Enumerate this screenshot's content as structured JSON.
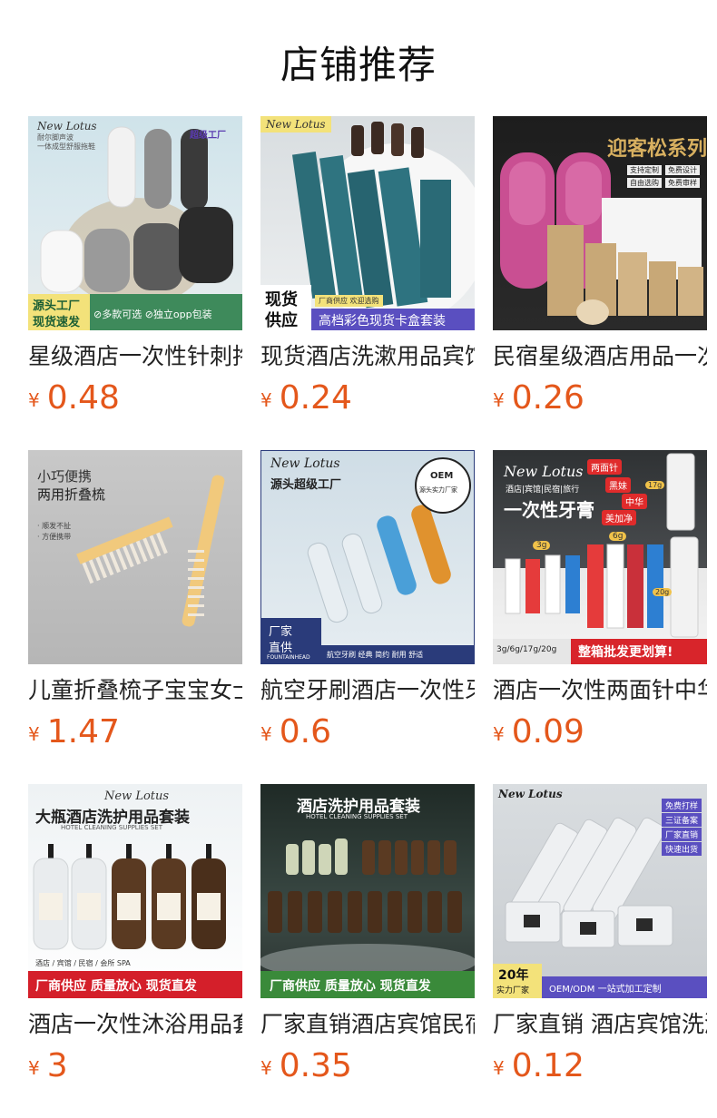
{
  "section_title": "店铺推荐",
  "products": [
    {
      "name": "星级酒店一次性针刺拖鞋",
      "currency": "¥",
      "price": "0.48",
      "image": {
        "brand": "New Lotus",
        "top_lines": [
          "耐尔脚声波",
          "一体成型舒服拖鞋"
        ],
        "badge": "超级工厂",
        "banner_left": [
          "源头工厂",
          "现货速发"
        ],
        "banner_right": "⊘多款可选 ⊘独立opp包装"
      }
    },
    {
      "name": "现货酒店洗漱用品宾馆套装",
      "currency": "¥",
      "price": "0.24",
      "image": {
        "brand": "New Lotus",
        "stamp": [
          "现货",
          "供应"
        ],
        "tag": "厂商供应 欢迎选购",
        "banner": "高档彩色现货卡盒套装"
      }
    },
    {
      "name": "民宿星级酒店用品一次性",
      "currency": "¥",
      "price": "0.26",
      "image": {
        "headline": "迎客松系列",
        "tags": [
          "支持定制",
          "免费设计",
          "自由选购",
          "免费审样"
        ]
      }
    },
    {
      "name": "儿童折叠梳子宝宝女士便携",
      "currency": "¥",
      "price": "1.47",
      "image": {
        "line1": "小巧便携",
        "line2": "两用折叠梳",
        "bullets": [
          "· 顺发不扯",
          "· 方便携带"
        ]
      }
    },
    {
      "name": "航空牙刷酒店一次性牙刷",
      "currency": "¥",
      "price": "0.6",
      "image": {
        "brand": "New Lotus",
        "subtitle": "源头超级工厂",
        "seal": [
          "OEM",
          "源头实力厂家"
        ],
        "corner": [
          "厂家",
          "直供",
          "FOUNTAINHEAD"
        ],
        "footer": "航空牙刷 经典 简约 耐用 舒适"
      }
    },
    {
      "name": "酒店一次性两面针中华牙膏",
      "currency": "¥",
      "price": "0.09",
      "image": {
        "brand": "New Lotus",
        "subtitle": "酒店|宾馆|民宿|旅行",
        "headline": "一次性牙膏",
        "brand_tags": [
          "两面针",
          "黑妹",
          "中华",
          "美加净"
        ],
        "sizes": [
          "3g",
          "6g",
          "17g",
          "20g"
        ],
        "footer_left": "3g/6g/17g/20g",
        "footer_right": "整箱批发更划算!"
      }
    },
    {
      "name": "酒店一次性沐浴用品套装",
      "currency": "¥",
      "price": "3",
      "image": {
        "brand": "New Lotus",
        "headline": "大瓶酒店洗护用品套装",
        "subline": "HOTEL CLEANING SUPPLIES SET",
        "venues": "酒店 / 宾馆 / 民宿 / 会所 SPA",
        "banner": "厂商供应  质量放心  现货直发"
      }
    },
    {
      "name": "厂家直销酒店宾馆民宿洗护",
      "currency": "¥",
      "price": "0.35",
      "image": {
        "headline": "酒店洗护用品套装",
        "subline": "HOTEL CLEANING SUPPLIES SET",
        "banner": "厂商供应  质量放心  现货直发"
      }
    },
    {
      "name": "厂家直销 酒店宾馆洗漱用品",
      "currency": "¥",
      "price": "0.12",
      "image": {
        "brand": "New Lotus",
        "tags": [
          "免费打样",
          "三证备案",
          "厂家直销",
          "快速出货"
        ],
        "years": [
          "20年",
          "实力厂家"
        ],
        "footer": "OEM/ODM 一站式加工定制"
      }
    }
  ]
}
